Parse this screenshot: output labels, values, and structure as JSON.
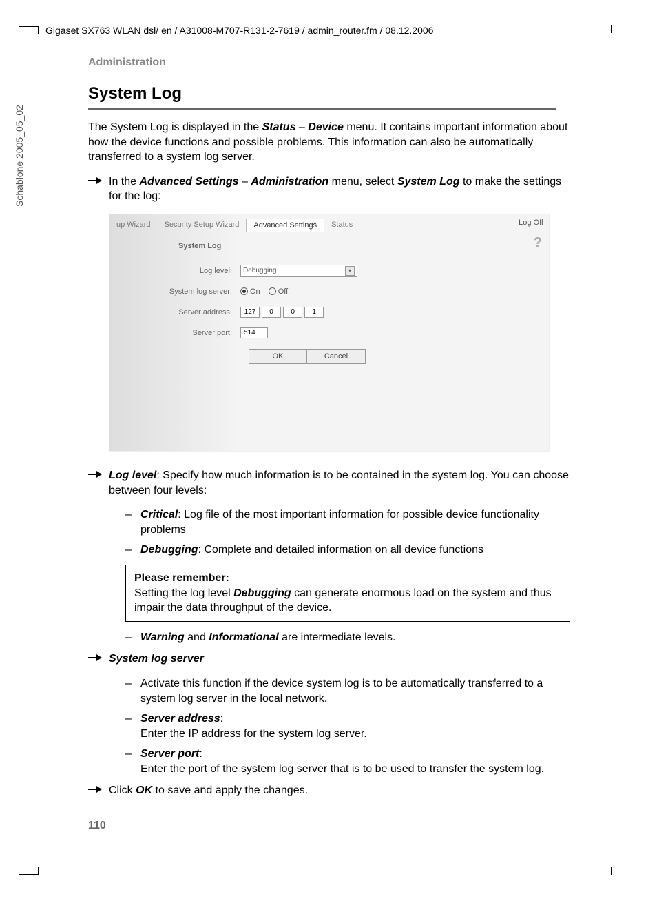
{
  "header_path": "Gigaset SX763 WLAN dsl/ en / A31008-M707-R131-2-7619 / admin_router.fm / 08.12.2006",
  "side_label": "Schablone 2005_05_02",
  "breadcrumb": "Administration",
  "title": "System Log",
  "intro_1": "The System Log is displayed in the ",
  "intro_status": "Status",
  "intro_dash": " – ",
  "intro_device": "Device",
  "intro_2": " menu. It contains important information about how the device functions and possible problems. This information can also be automatically transferred to a system log server.",
  "step1_a": "In the ",
  "step1_adv": "Advanced Settings",
  "step1_dash": " – ",
  "step1_admin": "Administration",
  "step1_b": " menu, select ",
  "step1_syslog": "System Log",
  "step1_c": " to make the settings for the log:",
  "ss": {
    "tabs": {
      "setup": "up Wizard",
      "security": "Security Setup Wizard",
      "advanced": "Advanced Settings",
      "status": "Status"
    },
    "logoff": "Log Off",
    "help": "?",
    "title": "System Log",
    "labels": {
      "loglevel": "Log level:",
      "server": "System log server:",
      "address": "Server address:",
      "port": "Server port:"
    },
    "loglevel_value": "Debugging",
    "radio_on": "On",
    "radio_off": "Off",
    "ip": [
      "127",
      "0",
      "0",
      "1"
    ],
    "ip_dot": ".",
    "port": "514",
    "ok": "OK",
    "cancel": "Cancel"
  },
  "loglevel_lead_b": "Log level",
  "loglevel_lead": ": Specify how much information is to be contained in the system log. You can choose between four levels:",
  "critical_b": "Critical",
  "critical_t": ": Log file of the most important information for possible device functionality problems",
  "debugging_b": "Debugging",
  "debugging_t": ": Complete and detailed information on all device functions",
  "note_title": "Please remember:",
  "note_a": "Setting the log level ",
  "note_b": "Debugging",
  "note_c": " can generate enormous load on the system and thus impair the data throughput of the device.",
  "warn_b1": "Warning",
  "warn_mid": " and ",
  "warn_b2": "Informational",
  "warn_t": " are intermediate levels.",
  "sls_heading": "System log server",
  "sls_activate": "Activate this function if the device system log is to be automatically transferred to a system log server in the local network.",
  "sa_b": "Server address",
  "sa_colon": ":",
  "sa_t": "Enter the IP address for the system log server.",
  "sp_b": "Server port",
  "sp_t": "Enter the port of the system log server that is to be used to transfer the system log.",
  "final_a": "Click ",
  "final_ok": "OK",
  "final_b": " to save and apply the changes.",
  "page": "110",
  "dash": "–"
}
